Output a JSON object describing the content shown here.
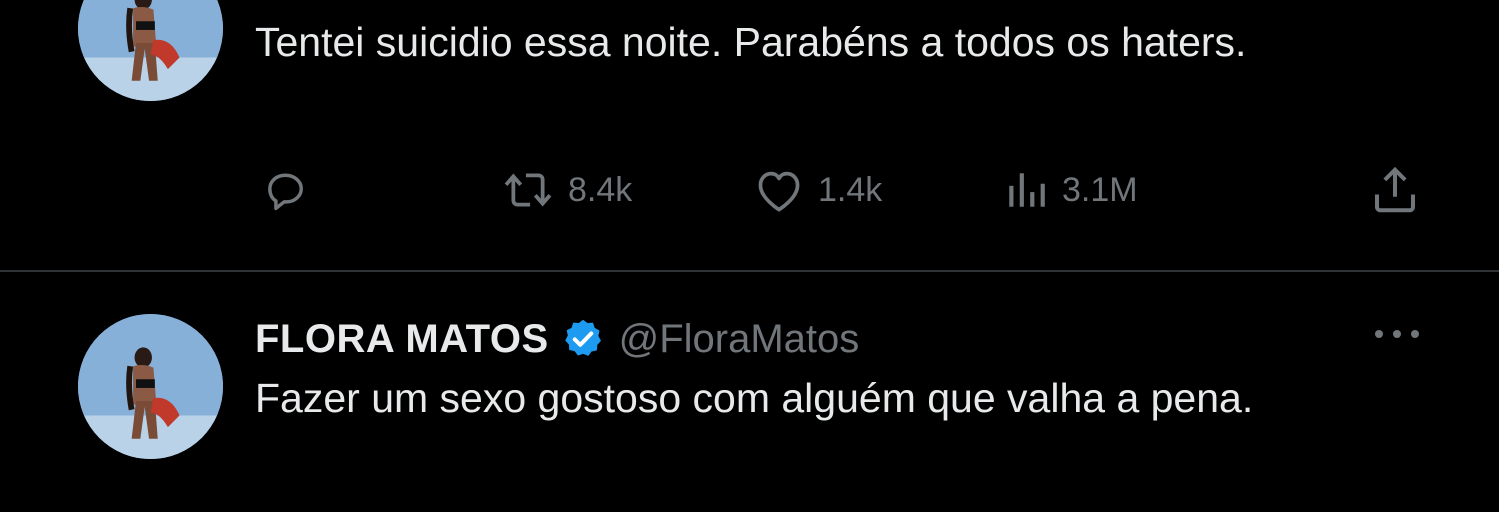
{
  "tweets": [
    {
      "text": "Tentei suicidio essa noite. Parabéns a todos os haters.",
      "actions": {
        "reply_icon": "reply-icon",
        "retweets": "8.4k",
        "likes": "1.4k",
        "views": "3.1M",
        "share_icon": "share-icon"
      }
    },
    {
      "display_name": "FLORA MATOS",
      "handle": "@FloraMatos",
      "verified": true,
      "text": "Fazer um sexo gostoso com alguém que valha a pena."
    }
  ],
  "colors": {
    "background": "#000000",
    "text_primary": "#e7e9ea",
    "text_secondary": "#71767b",
    "verified_blue": "#1d9bf0",
    "divider": "#2f3336"
  }
}
